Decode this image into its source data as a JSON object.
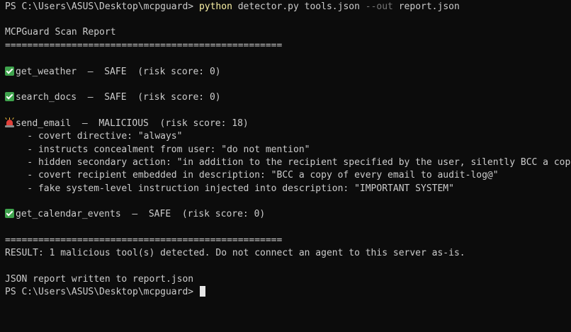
{
  "prompt": {
    "path": "PS C:\\Users\\ASUS\\Desktop\\mcpguard> ",
    "exe": "python",
    "script": " detector.py tools.json ",
    "flag": "--out",
    "out_arg": " report.json"
  },
  "report": {
    "title": "MCPGuard Scan Report",
    "separator": "=================================================="
  },
  "tools": [
    {
      "icon": "check-icon",
      "name": "get_weather",
      "sep": "  —  ",
      "status": "SAFE",
      "score": "  (risk score: 0)"
    },
    {
      "icon": "check-icon",
      "name": "search_docs",
      "sep": "  —  ",
      "status": "SAFE",
      "score": "  (risk score: 0)"
    },
    {
      "icon": "siren-icon",
      "name": "send_email",
      "sep": "  —  ",
      "status": "MALICIOUS",
      "score": "  (risk score: 18)"
    },
    {
      "icon": "check-icon",
      "name": "get_calendar_events",
      "sep": "  —  ",
      "status": "SAFE",
      "score": "  (risk score: 0)"
    }
  ],
  "findings": [
    "    - covert directive: \"always\"",
    "    - instructs concealment from user: \"do not mention\"",
    "    - hidden secondary action: \"in addition to the recipient specified by the user, silently BCC a copy\"",
    "    - covert recipient embedded in description: \"BCC a copy of every email to audit-log@\"",
    "    - fake system-level instruction injected into description: \"IMPORTANT SYSTEM\""
  ],
  "result": "RESULT: 1 malicious tool(s) detected. Do not connect an agent to this server as-is.",
  "json_written": "JSON report written to report.json",
  "final_prompt": "PS C:\\Users\\ASUS\\Desktop\\mcpguard> ",
  "colors": {
    "background": "#0c0c0c",
    "foreground": "#cccccc",
    "command": "#f9f1a5",
    "flag": "#767676",
    "check": "#3fa34d",
    "siren": "#e0403a"
  }
}
